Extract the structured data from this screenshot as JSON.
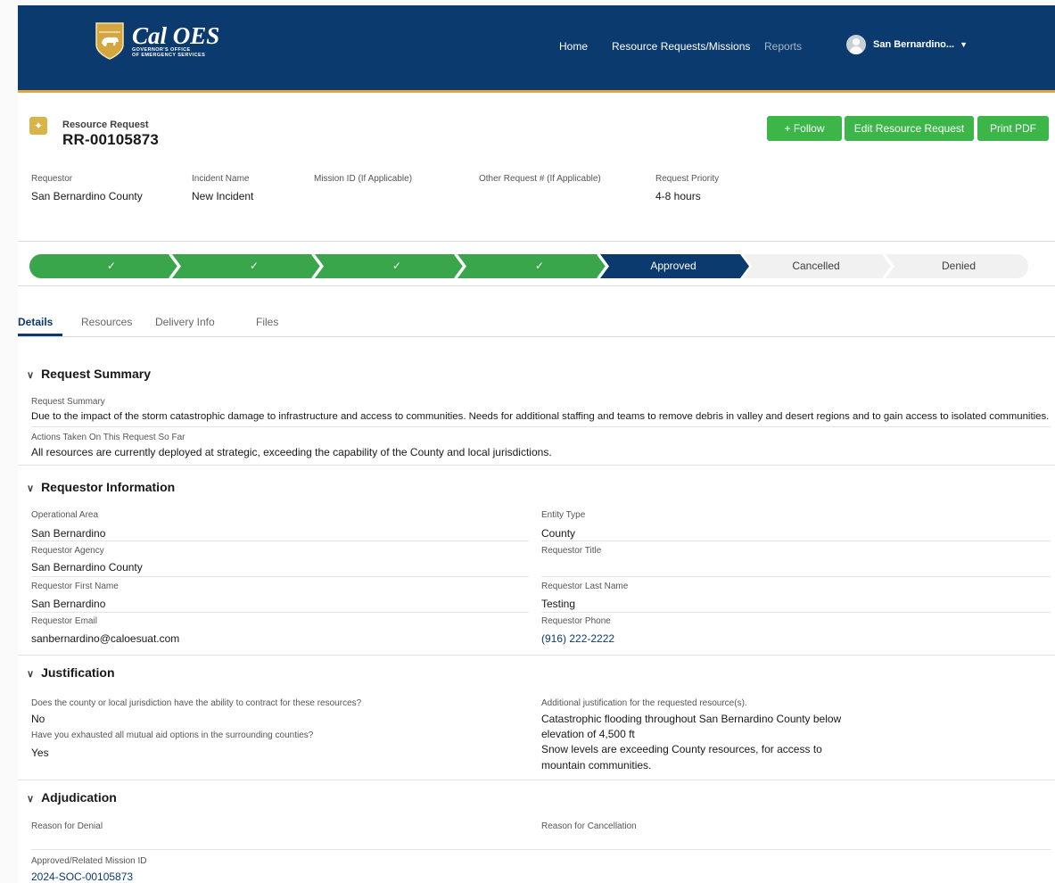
{
  "header": {
    "brand_name": "Cal OES",
    "brand_sub_1": "GOVERNOR'S OFFICE",
    "brand_sub_2": "OF EMERGENCY SERVICES",
    "nav": [
      "Home",
      "Resource Requests/Missions",
      "Reports"
    ],
    "user_name": "San Bernardino...",
    "colors": {
      "topbar": "#0b3a6e",
      "accent": "#e8a33d"
    }
  },
  "record": {
    "type_label": "Resource Request",
    "id": "RR-00105873",
    "icon": "resource-request-icon",
    "buttons": {
      "follow": "Follow",
      "edit": "Edit Resource Request",
      "print": "Print PDF"
    },
    "button_color": "#3cb549"
  },
  "highlights": [
    {
      "label": "Requestor",
      "value": "San Bernardino County"
    },
    {
      "label": "Incident Name",
      "value": "New Incident"
    },
    {
      "label": "Mission ID (If Applicable)",
      "value": ""
    },
    {
      "label": "Other Request # (If Applicable)",
      "value": ""
    },
    {
      "label": "Request Priority",
      "value": "4-8 hours"
    }
  ],
  "path": {
    "completed_mark": "✓",
    "current": "Approved",
    "upcoming": [
      "Cancelled",
      "Denied"
    ]
  },
  "tabs": [
    "Details",
    "Resources",
    "Delivery Info",
    "Files"
  ],
  "sections": {
    "summary": {
      "title": "Request Summary",
      "f1_label": "Request Summary",
      "f1_value": "Due to the impact of the storm catastrophic damage to infrastructure and access to communities. Needs for additional staffing and teams to remove debris in valley and desert regions and to gain access to isolated communities.",
      "f2_label": "Actions Taken On This Request So Far",
      "f2_value": "All resources are currently deployed at strategic, exceeding the capability of the County and local jurisdictions."
    },
    "requestor": {
      "title": "Requestor Information",
      "fields": [
        {
          "label": "Operational Area",
          "value": "San Bernardino"
        },
        {
          "label": "Entity Type",
          "value": "County"
        },
        {
          "label": "Requestor Agency",
          "value": "San Bernardino County"
        },
        {
          "label": "Requestor Title",
          "value": ""
        },
        {
          "label": "Requestor First Name",
          "value": "San Bernardino"
        },
        {
          "label": "Requestor Last Name",
          "value": "Testing"
        },
        {
          "label": "Requestor Email",
          "value": "sanbernardino@caloesuat.com"
        },
        {
          "label": "Requestor Phone",
          "value": "(916) 222-2222"
        }
      ]
    },
    "justification": {
      "title": "Justification",
      "q1_label": "Does the county or local jurisdiction have the ability to contract for these resources?",
      "q1_value": "No",
      "q2_label": "Have you exhausted all mutual aid options in the surrounding counties?",
      "q2_value": "Yes",
      "add_label": "Additional justification for the requested resource(s).",
      "add_lines": [
        "Catastrophic flooding throughout San Bernardino County below",
        "elevation of 4,500 ft",
        "Snow levels are exceeding County resources, for access to",
        "mountain communities."
      ]
    },
    "adjudication": {
      "title": "Adjudication",
      "denial_label": "Reason for Denial",
      "denial_value": "",
      "cancel_label": "Reason for Cancellation",
      "cancel_value": "",
      "mission_label": "Approved/Related Mission ID",
      "mission_value": "2024-SOC-00105873"
    }
  }
}
